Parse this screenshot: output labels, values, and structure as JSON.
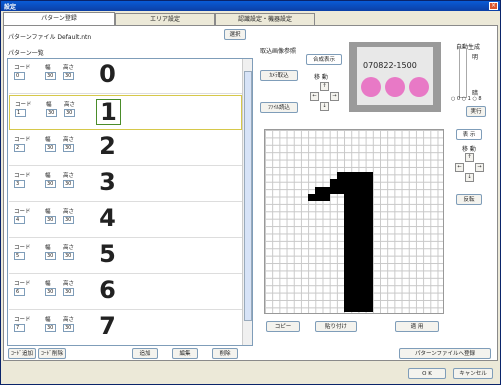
{
  "window": {
    "title": "設定",
    "close_symbol": "×"
  },
  "tabs": [
    {
      "label": "パターン登録"
    },
    {
      "label": "エリア設定"
    },
    {
      "label": "認識設定・機器設定"
    }
  ],
  "pattern_file": {
    "label": "パターンファイル Default.ntn",
    "select_button": "選択"
  },
  "pattern_list": {
    "label": "パターン一覧",
    "field_labels": {
      "code": "コード",
      "width": "幅",
      "height": "高さ"
    },
    "items": [
      {
        "code": "0",
        "width": "30",
        "height": "30",
        "glyph": "0"
      },
      {
        "code": "1",
        "width": "30",
        "height": "30",
        "glyph": "1"
      },
      {
        "code": "2",
        "width": "30",
        "height": "30",
        "glyph": "2"
      },
      {
        "code": "3",
        "width": "30",
        "height": "30",
        "glyph": "3"
      },
      {
        "code": "4",
        "width": "30",
        "height": "30",
        "glyph": "4"
      },
      {
        "code": "5",
        "width": "30",
        "height": "30",
        "glyph": "5"
      },
      {
        "code": "6",
        "width": "30",
        "height": "30",
        "glyph": "6"
      },
      {
        "code": "7",
        "width": "30",
        "height": "30",
        "glyph": "7"
      }
    ]
  },
  "capture": {
    "source_label": "取込画像参照",
    "source_value": "合成表示",
    "camera_button": "ｶﾒﾗ取込",
    "file_button": "ﾌｧｲﾙ読込",
    "move_label": "移 動",
    "camera_text": "070822-1500"
  },
  "auto_gen": {
    "label": "自動生成",
    "bright": "明",
    "dark": "暗",
    "options": "○ 0 ○ 1 ○ 8",
    "run_button": "実行"
  },
  "display": {
    "label": "表 示",
    "move_label": "移 動",
    "invert_button": "反転"
  },
  "arrows": {
    "up": "↑",
    "down": "↓",
    "left": "←",
    "right": "→"
  },
  "edit_buttons": {
    "copy": "コピー",
    "paste": "貼り付け",
    "apply": "適 用"
  },
  "bottom_buttons": {
    "code_add": "ｺｰﾄﾞ追加",
    "code_delete": "ｺｰﾄﾞ削除",
    "add": "追加",
    "edit": "編集",
    "delete": "削除",
    "register": "パターンファイルへ登録"
  },
  "dialog": {
    "ok": "O K",
    "cancel": "キャンセル"
  },
  "colors": {
    "title_bar": "#0a5bd6",
    "selection_border": "#d6c84a",
    "blob": "#e879c6"
  }
}
